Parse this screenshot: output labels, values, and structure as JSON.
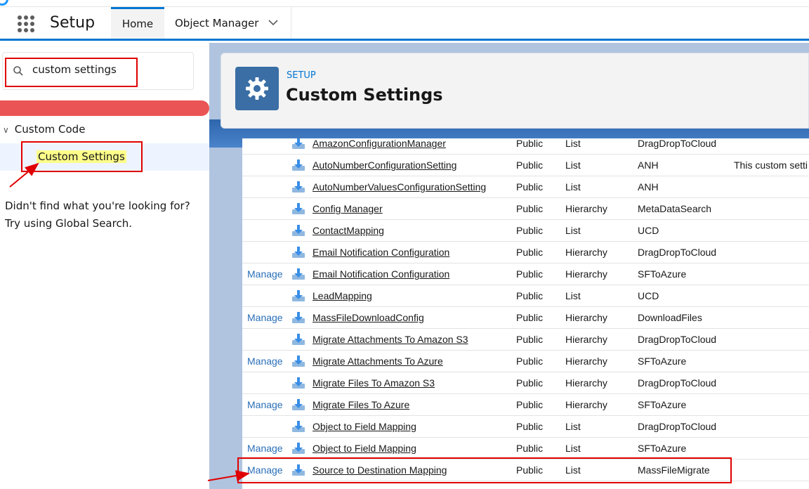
{
  "nav": {
    "app_name": "Setup",
    "tabs": [
      {
        "label": "Home"
      },
      {
        "label": "Object Manager"
      }
    ]
  },
  "sidebar": {
    "search_value": "custom settings",
    "tree_parent": "Custom Code",
    "tree_child": "Custom Settings",
    "not_found_line1": "Didn't find what you're looking for?",
    "not_found_line2": "Try using Global Search."
  },
  "header": {
    "eyebrow": "SETUP",
    "title": "Custom Settings"
  },
  "table": {
    "manage_label": "Manage",
    "rows": [
      {
        "manage": false,
        "label": "AmazonConfigurationManager",
        "visibility": "Public",
        "type": "List",
        "namespace": "DragDropToCloud",
        "description": ""
      },
      {
        "manage": false,
        "label": "AutoNumberConfigurationSetting",
        "visibility": "Public",
        "type": "List",
        "namespace": "ANH",
        "description": "This custom setti"
      },
      {
        "manage": false,
        "label": "AutoNumberValuesConfigurationSetting",
        "visibility": "Public",
        "type": "List",
        "namespace": "ANH",
        "description": ""
      },
      {
        "manage": false,
        "label": "Config Manager",
        "visibility": "Public",
        "type": "Hierarchy",
        "namespace": "MetaDataSearch",
        "description": ""
      },
      {
        "manage": false,
        "label": "ContactMapping",
        "visibility": "Public",
        "type": "List",
        "namespace": "UCD",
        "description": ""
      },
      {
        "manage": false,
        "label": "Email Notification Configuration",
        "visibility": "Public",
        "type": "Hierarchy",
        "namespace": "DragDropToCloud",
        "description": ""
      },
      {
        "manage": true,
        "label": "Email Notification Configuration",
        "visibility": "Public",
        "type": "Hierarchy",
        "namespace": "SFToAzure",
        "description": ""
      },
      {
        "manage": false,
        "label": "LeadMapping",
        "visibility": "Public",
        "type": "List",
        "namespace": "UCD",
        "description": ""
      },
      {
        "manage": true,
        "label": "MassFileDownloadConfig",
        "visibility": "Public",
        "type": "Hierarchy",
        "namespace": "DownloadFiles",
        "description": ""
      },
      {
        "manage": false,
        "label": "Migrate Attachments To Amazon S3",
        "visibility": "Public",
        "type": "Hierarchy",
        "namespace": "DragDropToCloud",
        "description": ""
      },
      {
        "manage": true,
        "label": "Migrate Attachments To Azure",
        "visibility": "Public",
        "type": "Hierarchy",
        "namespace": "SFToAzure",
        "description": ""
      },
      {
        "manage": false,
        "label": "Migrate Files To Amazon S3",
        "visibility": "Public",
        "type": "Hierarchy",
        "namespace": "DragDropToCloud",
        "description": ""
      },
      {
        "manage": true,
        "label": "Migrate Files To Azure",
        "visibility": "Public",
        "type": "Hierarchy",
        "namespace": "SFToAzure",
        "description": ""
      },
      {
        "manage": false,
        "label": "Object to Field Mapping",
        "visibility": "Public",
        "type": "List",
        "namespace": "DragDropToCloud",
        "description": ""
      },
      {
        "manage": true,
        "label": "Object to Field Mapping",
        "visibility": "Public",
        "type": "List",
        "namespace": "SFToAzure",
        "description": ""
      },
      {
        "manage": true,
        "label": "Source to Destination Mapping",
        "visibility": "Public",
        "type": "List",
        "namespace": "MassFileMigrate",
        "description": ""
      }
    ]
  },
  "colors": {
    "brand_blue": "#0176d3",
    "highlight_red": "#e00000",
    "search_highlight_yellow": "#fdfd8a"
  },
  "icons": [
    "app-launcher-icon",
    "search-icon",
    "chevron-down-icon",
    "gear-icon",
    "custom-setting-download-icon"
  ]
}
